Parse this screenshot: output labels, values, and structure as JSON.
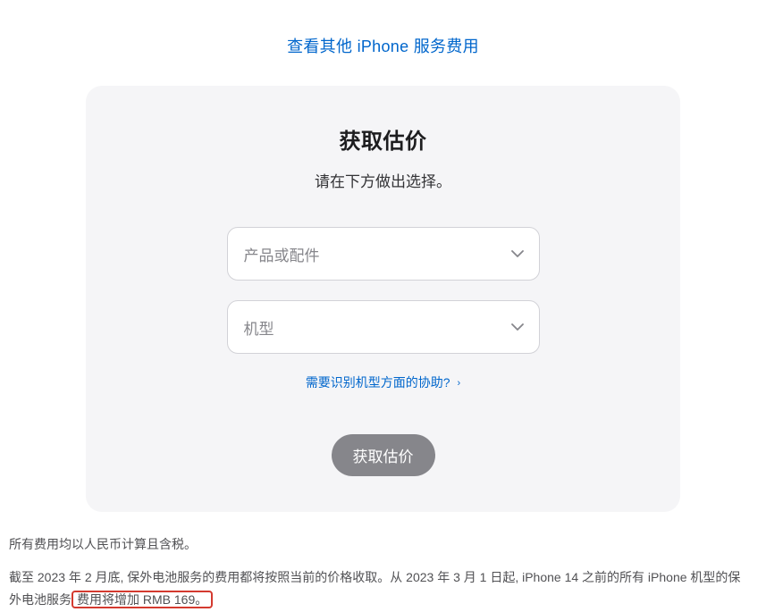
{
  "topLink": {
    "label": "查看其他 iPhone 服务费用"
  },
  "card": {
    "title": "获取估价",
    "subtitle": "请在下方做出选择。",
    "selects": {
      "product": {
        "placeholder": "产品或配件"
      },
      "model": {
        "placeholder": "机型"
      }
    },
    "helpLink": {
      "label": "需要识别机型方面的协助?",
      "chevron": "›"
    },
    "submit": {
      "label": "获取估价"
    }
  },
  "disclaimer": {
    "line1": "所有费用均以人民币计算且含税。",
    "line2_part1": "截至 2023 年 2 月底, 保外电池服务的费用都将按照当前的价格收取。从 2023 年 3 月 1 日起, iPhone 14 之前的所有 iPhone 机型的保外电池服务",
    "line2_highlight": "费用将增加 RMB 169。"
  }
}
